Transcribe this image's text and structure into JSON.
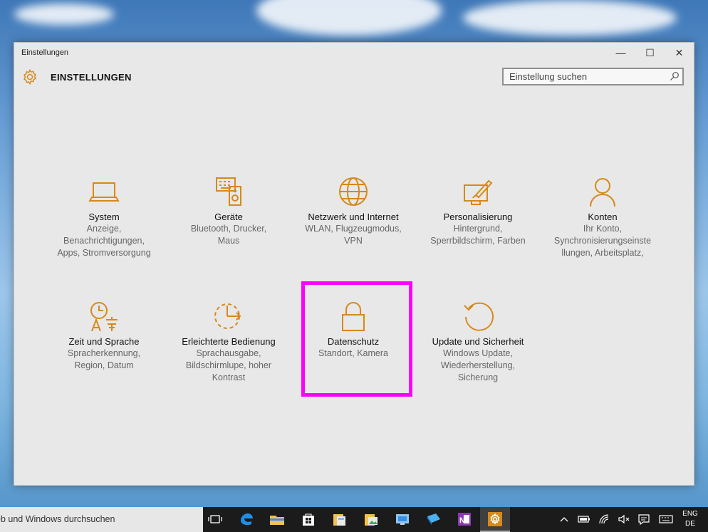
{
  "window": {
    "title": "Einstellungen",
    "controls": {
      "minimize": "—",
      "maximize": "☐",
      "close": "✕"
    }
  },
  "header": {
    "heading": "EINSTELLUNGEN",
    "search_placeholder": "Einstellung suchen"
  },
  "tiles": [
    {
      "title": "System",
      "desc": [
        "Anzeige,",
        "Benachrichtigungen,",
        "Apps, Stromversorgung"
      ],
      "icon": "laptop-icon"
    },
    {
      "title": "Geräte",
      "desc": [
        "Bluetooth, Drucker,",
        "Maus"
      ],
      "icon": "devices-icon"
    },
    {
      "title": "Netzwerk und Internet",
      "desc": [
        "WLAN, Flugzeugmodus,",
        "VPN"
      ],
      "icon": "globe-icon"
    },
    {
      "title": "Personalisierung",
      "desc": [
        "Hintergrund,",
        "Sperrbildschirm, Farben"
      ],
      "icon": "paintbrush-icon"
    },
    {
      "title": "Konten",
      "desc": [
        "Ihr Konto,",
        "Synchronisierungseinste",
        "llungen, Arbeitsplatz,"
      ],
      "icon": "person-icon"
    },
    {
      "title": "Zeit und Sprache",
      "desc": [
        "Spracherkennung,",
        "Region, Datum"
      ],
      "icon": "time-language-icon"
    },
    {
      "title": "Erleichterte Bedienung",
      "desc": [
        "Sprachausgabe,",
        "Bildschirmlupe, hoher",
        "Kontrast"
      ],
      "icon": "ease-of-access-icon"
    },
    {
      "title": "Datenschutz",
      "desc": [
        "Standort, Kamera"
      ],
      "icon": "lock-icon"
    },
    {
      "title": "Update und Sicherheit",
      "desc": [
        "Windows Update,",
        "Wiederherstellung,",
        "Sicherung"
      ],
      "icon": "refresh-icon"
    }
  ],
  "taskbar": {
    "search_text": "eb und Windows durchsuchen",
    "lang_top": "ENG",
    "lang_bottom": "DE"
  },
  "colors": {
    "accent": "#d6891a",
    "highlight": "#ff00ff"
  }
}
